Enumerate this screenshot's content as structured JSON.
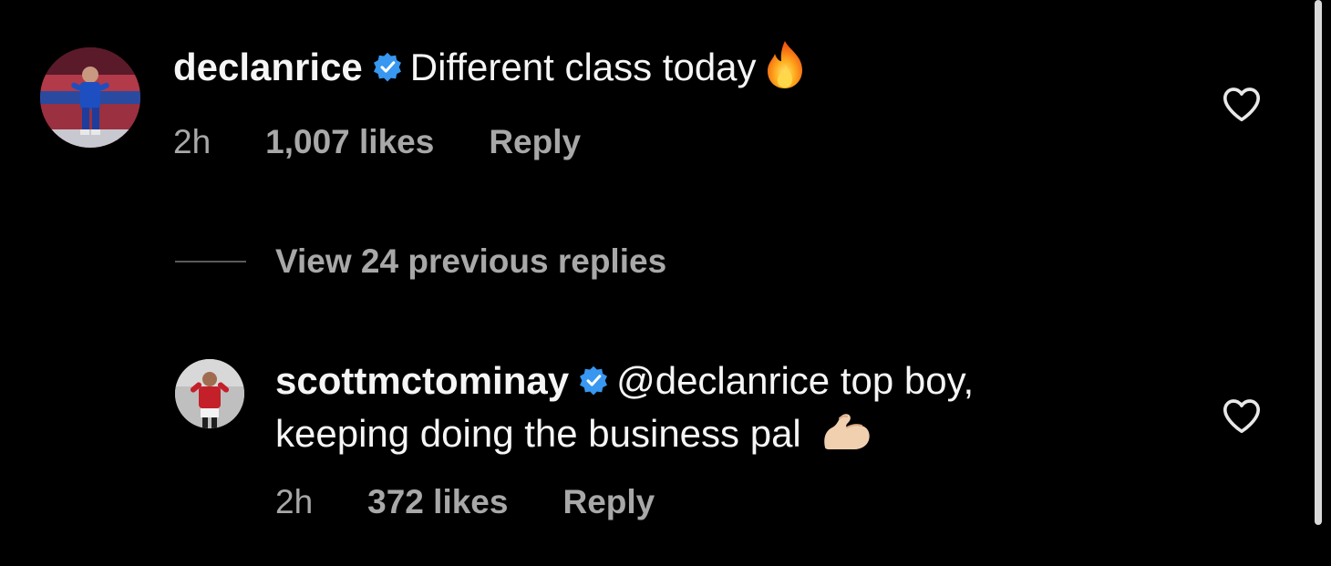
{
  "comments": [
    {
      "username": "declanrice",
      "verified": true,
      "text": "Different class today",
      "emoji": "fire-emoji",
      "time": "2h",
      "likes": "1,007 likes",
      "reply_label": "Reply",
      "avatar": "declanrice-avatar"
    },
    {
      "username": "scottmctominay",
      "verified": true,
      "mention": "@declanrice",
      "text_line1": " top boy,",
      "text_line2": "keeping doing the business pal",
      "emoji": "flexed-biceps-emoji",
      "time": "2h",
      "likes": "372 likes",
      "reply_label": "Reply",
      "avatar": "scottmctominay-avatar"
    }
  ],
  "view_replies": {
    "label": "View 24 previous replies"
  },
  "colors": {
    "background": "#000000",
    "text": "#f5f5f5",
    "secondary": "#a8a8a8",
    "verified_badge": "#3897f0"
  }
}
